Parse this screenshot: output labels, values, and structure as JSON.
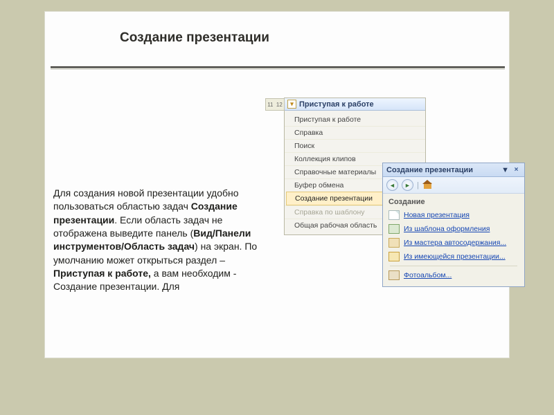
{
  "title": "Создание презентации",
  "body": {
    "p1a": "Для создания новой презентации удобно пользоваться областью задач ",
    "p1b_bold": "Создание презентации",
    "p1c": ". Если область задач не отображена выведите панель (",
    "p1d_bold": "Вид/Панели инструментов/Область задач",
    "p1e": ") на экран. По умолчанию может открыться раздел – ",
    "p1f_bold": "Приступая к работе,",
    "p1g": " а вам необходим - Создание презентации. Для"
  },
  "ruler": {
    "a": "11",
    "b": "12"
  },
  "leftPane": {
    "header": "Приступая к работе",
    "items": [
      "Приступая к работе",
      "Справка",
      "Поиск",
      "Коллекция клипов",
      "Справочные материалы",
      "Буфер обмена",
      "Создание презентации",
      "Справка по шаблону",
      "Общая рабочая область"
    ],
    "activeIndex": 6,
    "dim": [
      7
    ]
  },
  "rightPane": {
    "header": "Создание презентации",
    "dropdownGlyph": "▼",
    "closeGlyph": "×",
    "section": "Создание",
    "links": [
      {
        "icon": "doc",
        "text": "Новая презентация"
      },
      {
        "icon": "tmpl",
        "text": "Из шаблона оформления"
      },
      {
        "icon": "wiz",
        "text": "Из мастера автосодержания..."
      },
      {
        "icon": "open",
        "text": "Из имеющейся презентации..."
      },
      {
        "icon": "photo",
        "text": "Фотоальбом..."
      }
    ]
  }
}
